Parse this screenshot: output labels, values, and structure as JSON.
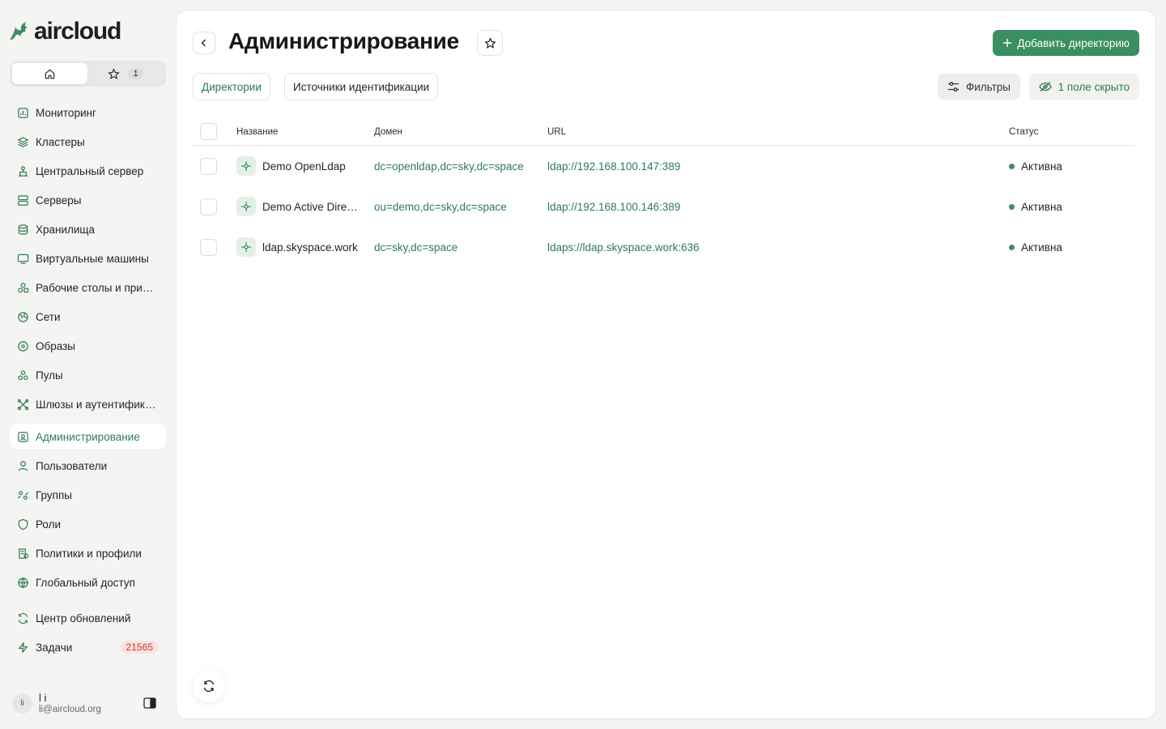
{
  "app": {
    "logo_text": "aircloud"
  },
  "sidebar": {
    "view_toggle": {
      "favorites_count": "1"
    },
    "items": [
      {
        "label": "Мониторинг",
        "icon": "chart-icon"
      },
      {
        "label": "Кластеры",
        "icon": "layers-icon"
      },
      {
        "label": "Центральный сервер",
        "icon": "central-server-icon"
      },
      {
        "label": "Серверы",
        "icon": "server-icon"
      },
      {
        "label": "Хранилища",
        "icon": "database-icon"
      },
      {
        "label": "Виртуальные машины",
        "icon": "monitor-icon"
      },
      {
        "label": "Рабочие столы и приложения",
        "icon": "shapes-icon"
      },
      {
        "label": "Сети",
        "icon": "globe-network-icon"
      },
      {
        "label": "Образы",
        "icon": "disc-icon"
      },
      {
        "label": "Пулы",
        "icon": "pools-icon"
      },
      {
        "label": "Шлюзы и аутентификация",
        "icon": "gateway-icon"
      },
      {
        "label": "Администрирование",
        "icon": "admin-icon",
        "active": true
      },
      {
        "label": "Пользователи",
        "icon": "user-icon"
      },
      {
        "label": "Группы",
        "icon": "group-icon"
      },
      {
        "label": "Роли",
        "icon": "shield-icon"
      },
      {
        "label": "Политики и профили",
        "icon": "policy-icon"
      },
      {
        "label": "Глобальный доступ",
        "icon": "globe-icon"
      },
      {
        "label": "Центр обновлений",
        "icon": "refresh-icon"
      },
      {
        "label": "Задачи",
        "icon": "lightning-icon",
        "badge": "21565"
      }
    ],
    "user": {
      "initials": "li",
      "name": "l i",
      "email": "li@aircloud.org"
    }
  },
  "header": {
    "title": "Администрирование",
    "add_button_label": "Добавить директорию"
  },
  "tabs": [
    {
      "label": "Директории",
      "active": true
    },
    {
      "label": "Источники идентификации",
      "active": false
    }
  ],
  "toolbar": {
    "filters_label": "Фильтры",
    "hidden_fields_label": "1 поле скрыто"
  },
  "table": {
    "columns": [
      "Название",
      "Домен",
      "URL",
      "Статус"
    ],
    "rows": [
      {
        "name": "Demo OpenLdap",
        "domain": "dc=openldap,dc=sky,dc=space",
        "url": "ldap://192.168.100.147:389",
        "status": "Активна"
      },
      {
        "name": "Demo Active Directory",
        "domain": "ou=demo,dc=sky,dc=space",
        "url": "ldap://192.168.100.146:389",
        "status": "Активна"
      },
      {
        "name": "ldap.skyspace.work",
        "domain": "dc=sky,dc=space",
        "url": "ldaps://ldap.skyspace.work:636",
        "status": "Активна"
      }
    ]
  },
  "colors": {
    "accent": "#3a8f62",
    "accent_text": "#2f7a55",
    "badge_red": "#d0342c"
  }
}
